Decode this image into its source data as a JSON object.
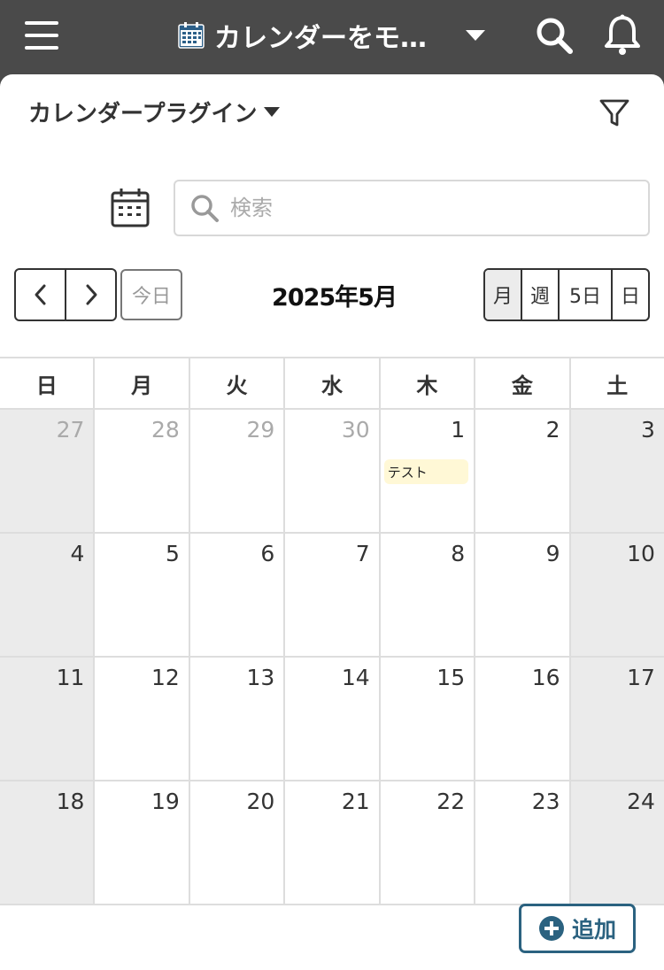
{
  "header": {
    "app_title": "カレンダーをモ…"
  },
  "toolbar": {
    "view_name": "カレンダープラグイン",
    "search_placeholder": "検索"
  },
  "calendar": {
    "today_label": "今日",
    "month_title": "2025年5月",
    "view_buttons": [
      "月",
      "週",
      "5日",
      "日"
    ],
    "active_view": "月",
    "weekdays": [
      "日",
      "月",
      "火",
      "水",
      "木",
      "金",
      "土"
    ],
    "weeks": [
      [
        "27",
        "28",
        "29",
        "30",
        "1",
        "2",
        "3"
      ],
      [
        "4",
        "5",
        "6",
        "7",
        "8",
        "9",
        "10"
      ],
      [
        "11",
        "12",
        "13",
        "14",
        "15",
        "16",
        "17"
      ],
      [
        "18",
        "19",
        "20",
        "21",
        "22",
        "23",
        "24"
      ]
    ],
    "event": {
      "title": "テスト",
      "date": "1"
    }
  },
  "footer": {
    "add_label": "追加"
  },
  "colors": {
    "header_bg": "#4a4a4a",
    "weekend_bg": "#ebebeb",
    "event_bg": "#fff8d6",
    "add_accent": "#2b6280"
  }
}
